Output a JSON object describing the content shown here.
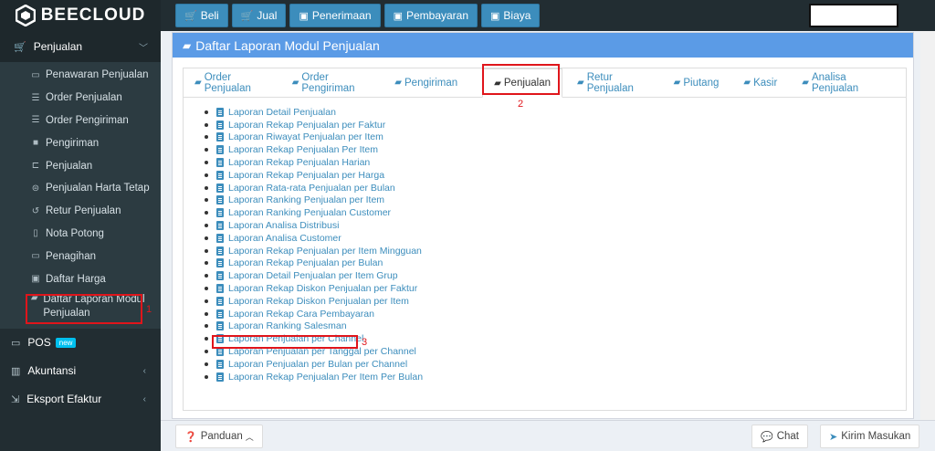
{
  "brand": {
    "name": "BEECLOUD"
  },
  "topnav": [
    {
      "label": "Beli",
      "icon": "cart-icon"
    },
    {
      "label": "Jual",
      "icon": "cart-icon"
    },
    {
      "label": "Penerimaan",
      "icon": "money-icon"
    },
    {
      "label": "Pembayaran",
      "icon": "money-icon"
    },
    {
      "label": "Biaya",
      "icon": "money-icon"
    }
  ],
  "sidebar": {
    "section": "Penjualan",
    "items": [
      {
        "label": "Penawaran Penjualan",
        "icon": "card-icon"
      },
      {
        "label": "Order Penjualan",
        "icon": "list-icon"
      },
      {
        "label": "Order Pengiriman",
        "icon": "list-icon"
      },
      {
        "label": "Pengiriman",
        "icon": "truck-icon"
      },
      {
        "label": "Penjualan",
        "icon": "cart-icon"
      },
      {
        "label": "Penjualan Harta Tetap",
        "icon": "car-icon"
      },
      {
        "label": "Retur Penjualan",
        "icon": "undo-icon"
      },
      {
        "label": "Nota Potong",
        "icon": "file-icon"
      },
      {
        "label": "Penagihan",
        "icon": "card-icon"
      },
      {
        "label": "Daftar Harga",
        "icon": "money-icon"
      },
      {
        "label": "Daftar Laporan Modul Penjualan",
        "icon": "book-icon"
      }
    ],
    "main": [
      {
        "label": "POS",
        "badge": "new",
        "icon": "monitor-icon"
      },
      {
        "label": "Akuntansi",
        "icon": "chart-icon"
      },
      {
        "label": "Eksport Efaktur",
        "icon": "export-icon"
      }
    ]
  },
  "panel": {
    "title": "Daftar Laporan Modul Penjualan",
    "tabs": [
      "Order Penjualan",
      "Order Pengiriman",
      "Pengiriman",
      "Penjualan",
      "Retur Penjualan",
      "Piutang",
      "Kasir",
      "Analisa Penjualan"
    ],
    "reports": [
      "Laporan Detail Penjualan",
      "Laporan Rekap Penjualan per Faktur",
      "Laporan Riwayat Penjualan per Item",
      "Laporan Rekap Penjualan Per Item",
      "Laporan Rekap Penjualan Harian",
      "Laporan Rekap Penjualan per Harga",
      "Laporan Rata-rata Penjualan per Bulan",
      "Laporan Ranking Penjualan per Item",
      "Laporan Ranking Penjualan Customer",
      "Laporan Analisa Distribusi",
      "Laporan Analisa Customer",
      "Laporan Rekap Penjualan per Item Mingguan",
      "Laporan Rekap Penjualan per Bulan",
      "Laporan Detail Penjualan per Item Grup",
      "Laporan Rekap Diskon Penjualan per Faktur",
      "Laporan Rekap Diskon Penjualan per Item",
      "Laporan Rekap Cara Pembayaran",
      "Laporan Ranking Salesman",
      "Laporan Penjualan per Channel",
      "Laporan Penjualan per Tanggal per Channel",
      "Laporan Penjualan per Bulan per Channel",
      "Laporan Rekap Penjualan Per Item Per Bulan"
    ]
  },
  "annotations": {
    "one": "1",
    "two": "2",
    "three": "3"
  },
  "footer": {
    "panduan": "Panduan",
    "chat": "Chat",
    "kirim": "Kirim Masukan"
  },
  "colors": {
    "accent": "#3c8dbc",
    "panel_header": "#5b9be6",
    "sidebar_bg": "#222d32",
    "annotation": "#e0151b"
  }
}
